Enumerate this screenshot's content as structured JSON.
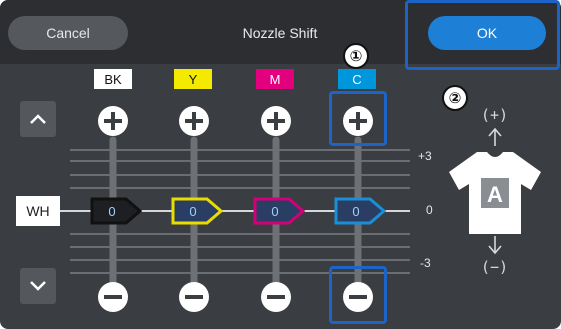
{
  "header": {
    "cancel_label": "Cancel",
    "title": "Nozzle Shift",
    "ok_label": "OK"
  },
  "channels": [
    {
      "label": "BK",
      "chip_bg": "#ffffff",
      "chip_fg": "#111111",
      "border": "#111111",
      "value": "0"
    },
    {
      "label": "Y",
      "chip_bg": "#f4e900",
      "chip_fg": "#111111",
      "border": "#e8dd00",
      "value": "0"
    },
    {
      "label": "M",
      "chip_bg": "#e2007e",
      "chip_fg": "#ffffff",
      "border": "#d4007a",
      "value": "0"
    },
    {
      "label": "C",
      "chip_bg": "#0096dc",
      "chip_fg": "#ffffff",
      "border": "#1a8fd6",
      "value": "0"
    }
  ],
  "wh_label": "WH",
  "scale": {
    "top": "+3",
    "mid": "0",
    "bottom": "-3"
  },
  "shirt": {
    "plus_label": "(+)",
    "minus_label": "(−)",
    "letter": "A"
  },
  "callouts": {
    "one": "①",
    "two": "②"
  },
  "colors": {
    "accent": "#1e7fd6",
    "callout": "#1c64c8",
    "background": "#3a3d42"
  }
}
